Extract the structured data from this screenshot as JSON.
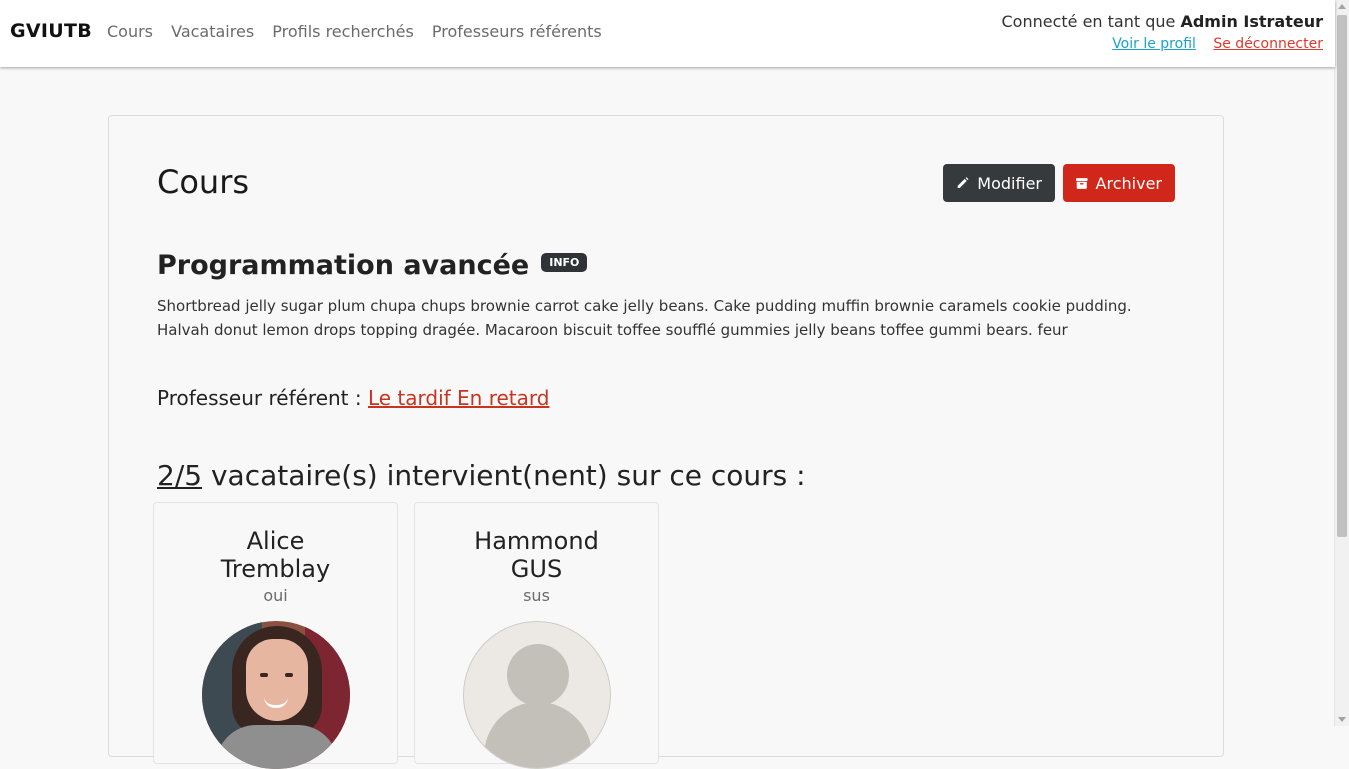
{
  "navbar": {
    "brand": "GVIUTB",
    "links": [
      "Cours",
      "Vacataires",
      "Profils recherchés",
      "Professeurs référents"
    ],
    "user_prefix": "Connecté en tant que",
    "user_name": "Admin Istrateur",
    "profile_link": "Voir le profil",
    "logout_link": "Se déconnecter"
  },
  "page": {
    "title": "Cours",
    "modify_label": "Modifier",
    "archive_label": "Archiver"
  },
  "course": {
    "name": "Programmation avancée",
    "badge": "INFO",
    "description": "Shortbread jelly sugar plum chupa chups brownie carrot cake jelly beans. Cake pudding muffin brownie caramels cookie pudding. Halvah donut lemon drops topping dragée. Macaroon biscuit toffee soufflé gummies jelly beans toffee gummi bears. feur",
    "prof_label": "Professeur référent :",
    "prof_name": "Le tardif En retard"
  },
  "vacataires": {
    "count": "2/5",
    "heading_suffix": "vacataire(s) intervient(nent) sur ce cours :",
    "items": [
      {
        "first": "Alice",
        "last": "Tremblay",
        "sub": "oui",
        "avatar": "photo"
      },
      {
        "first": "Hammond",
        "last": "GUS",
        "sub": "sus",
        "avatar": "default-avatar-icon"
      }
    ]
  },
  "colors": {
    "modify_button": "#363a3d",
    "archive_button": "#d1261a",
    "profile_link": "#1aa3c9",
    "logout_link": "#d93a2b",
    "prof_link": "#c8341f"
  }
}
